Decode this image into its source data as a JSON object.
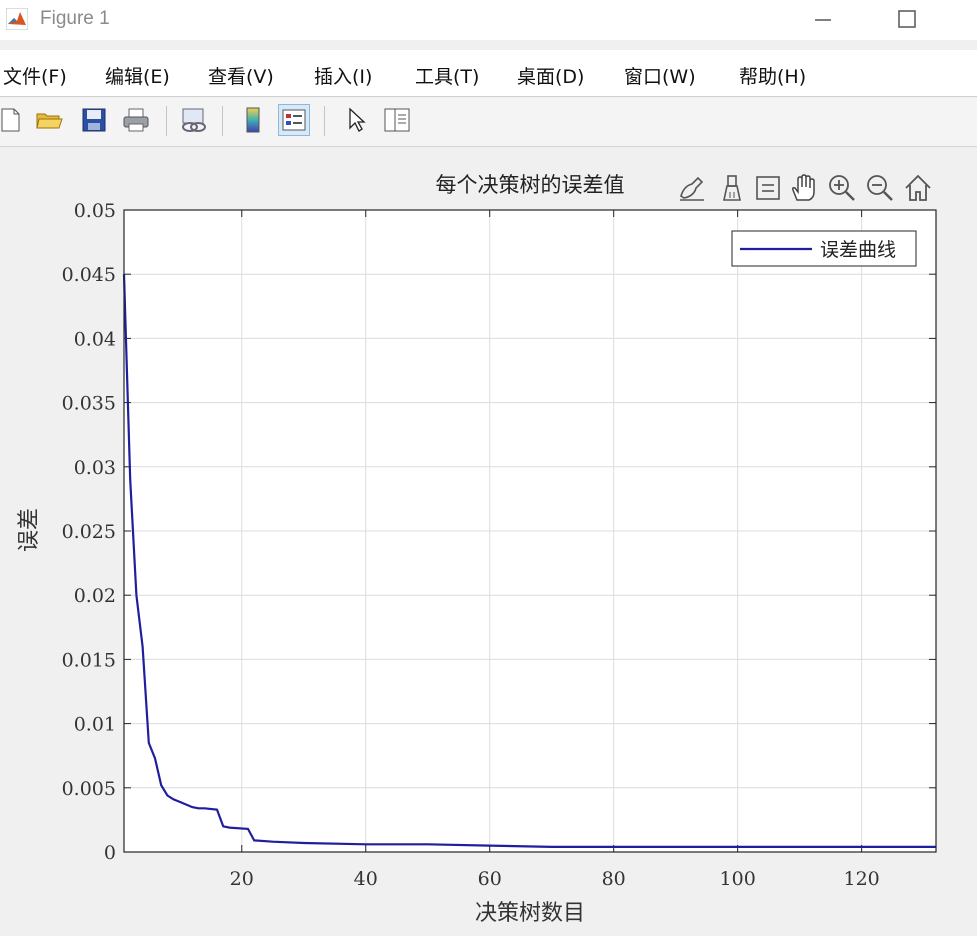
{
  "window": {
    "title": "Figure 1"
  },
  "menu": [
    "文件(F)",
    "编辑(E)",
    "查看(V)",
    "插入(I)",
    "工具(T)",
    "桌面(D)",
    "窗口(W)",
    "帮助(H)"
  ],
  "toolbar_icons": [
    "new-figure-icon",
    "open-folder-icon",
    "save-icon",
    "print-icon",
    "link-plot-icon",
    "colorbar-icon",
    "legend-icon",
    "edit-pointer-icon",
    "property-inspector-icon"
  ],
  "axes_toolbar_icons": [
    "brush-icon",
    "data-tips-icon",
    "restore-view-icon",
    "pan-icon",
    "zoom-in-icon",
    "zoom-out-icon",
    "home-icon"
  ],
  "chart_data": {
    "type": "line",
    "title": "每个决策树的误差值",
    "xlabel": "决策树数目",
    "ylabel": "误差",
    "xlim": [
      1,
      132
    ],
    "ylim": [
      0,
      0.05
    ],
    "xticks": [
      20,
      40,
      60,
      80,
      100,
      120
    ],
    "yticks": [
      "0",
      "0.005",
      "0.01",
      "0.015",
      "0.02",
      "0.025",
      "0.03",
      "0.035",
      "0.04",
      "0.045",
      "0.05"
    ],
    "grid": true,
    "legend_position": "top-right",
    "series": [
      {
        "name": "误差曲线",
        "color": "#1f1f9e",
        "x": [
          1,
          2,
          3,
          4,
          5,
          6,
          7,
          8,
          9,
          10,
          12,
          13,
          14,
          16,
          17,
          18,
          21,
          22,
          25,
          30,
          40,
          50,
          60,
          70,
          80,
          90,
          100,
          110,
          120,
          132
        ],
        "y": [
          0.045,
          0.029,
          0.02,
          0.016,
          0.0085,
          0.0073,
          0.0052,
          0.0044,
          0.0041,
          0.0039,
          0.0035,
          0.0034,
          0.0034,
          0.0033,
          0.002,
          0.0019,
          0.0018,
          0.0009,
          0.0008,
          0.0007,
          0.0006,
          0.0006,
          0.0005,
          0.0004,
          0.0004,
          0.0004,
          0.0004,
          0.0004,
          0.0004,
          0.0004
        ]
      }
    ]
  }
}
